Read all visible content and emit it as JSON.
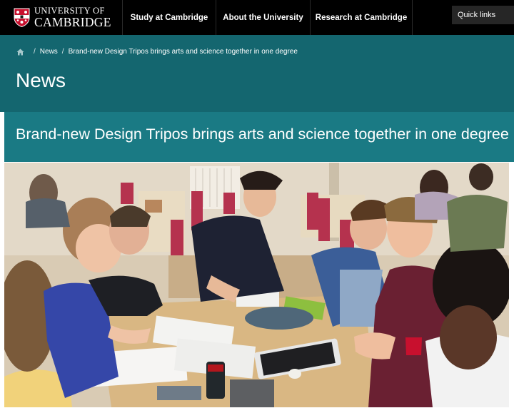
{
  "header": {
    "logo": {
      "line1": "UNIVERSITY OF",
      "line2": "CAMBRIDGE"
    },
    "nav": [
      {
        "label": "Study at Cambridge"
      },
      {
        "label": "About the University"
      },
      {
        "label": "Research at Cambridge"
      }
    ],
    "quick_links": "Quick links"
  },
  "breadcrumb": {
    "home_icon": "home-icon",
    "separator": "/",
    "items": [
      {
        "label": "News"
      },
      {
        "label": "Brand-new Design Tripos brings arts and science together in one degree"
      }
    ]
  },
  "page": {
    "title": "News",
    "headline": "Brand-new Design Tripos brings arts and science together in one degree"
  },
  "colors": {
    "header_bg": "#000000",
    "banner_teal": "#14666f",
    "headline_teal": "#1a7a84"
  }
}
